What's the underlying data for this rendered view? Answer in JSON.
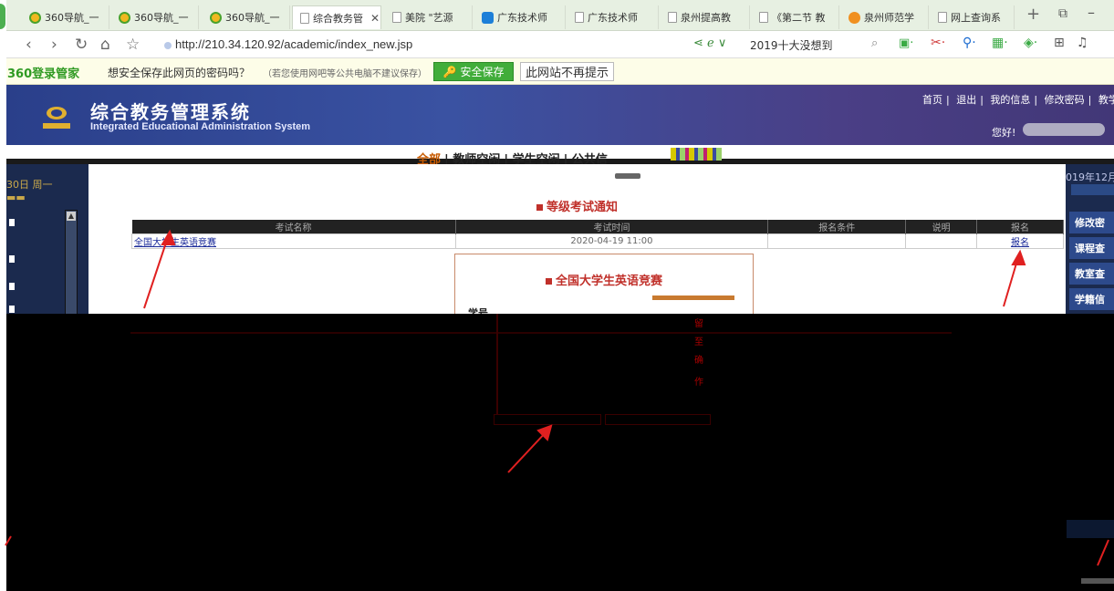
{
  "browser": {
    "tabs": [
      {
        "label": "360导航_一",
        "icon": "360-logo-icon"
      },
      {
        "label": "360导航_一",
        "icon": "360-logo-icon"
      },
      {
        "label": "360导航_一",
        "icon": "360-logo-icon"
      },
      {
        "label": "综合教务管",
        "icon": "document-icon",
        "active": true
      },
      {
        "label": "美院 \"艺源",
        "icon": "document-icon"
      },
      {
        "label": "广东技术师",
        "icon": "shield-icon"
      },
      {
        "label": "广东技术师",
        "icon": "document-icon"
      },
      {
        "label": "泉州提高教",
        "icon": "document-icon"
      },
      {
        "label": "《第二节 教",
        "icon": "document-icon"
      },
      {
        "label": "泉州师范学",
        "icon": "face-icon"
      },
      {
        "label": "网上查询系",
        "icon": "document-icon"
      }
    ],
    "url": "http://210.34.120.92/academic/index_new.jsp",
    "search_text": "2019十大没想到",
    "accent_color": "#41ad3a"
  },
  "password_bar": {
    "brand": "360登录管家",
    "message": "想安全保存此网页的密码吗？",
    "hint": "（若您使用网吧等公共电脑不建议保存）",
    "save_label": "安全保存",
    "dismiss_label": "此网站不再提示"
  },
  "app": {
    "title": "综合教务管理系统",
    "subtitle": "Integrated Educational Administration System",
    "top_nav": [
      "首页",
      "退出",
      "我的信息",
      "修改密码",
      "教学"
    ],
    "greeting": "您好!",
    "nav_links": [
      "全部",
      "教师空闲",
      "学生空闲",
      "公共信"
    ],
    "left_date": "30日 周一",
    "right_date": "019年12月",
    "right_buttons": [
      "修改密",
      "课程查",
      "教室查",
      "学籍信"
    ]
  },
  "exam": {
    "section_title": "等级考试通知",
    "columns": [
      "考试名称",
      "考试时间",
      "报名条件",
      "说明",
      "报名"
    ],
    "rows": [
      {
        "name": "全国大学生英语竞赛",
        "time": "2020-04-19 11:00",
        "condition": "",
        "note": "",
        "action": "报名"
      }
    ],
    "popup_title": "全国大学生英语竞赛",
    "popup_label": "学号",
    "popup_side_chars": [
      "留",
      "至",
      "确",
      "作"
    ]
  }
}
